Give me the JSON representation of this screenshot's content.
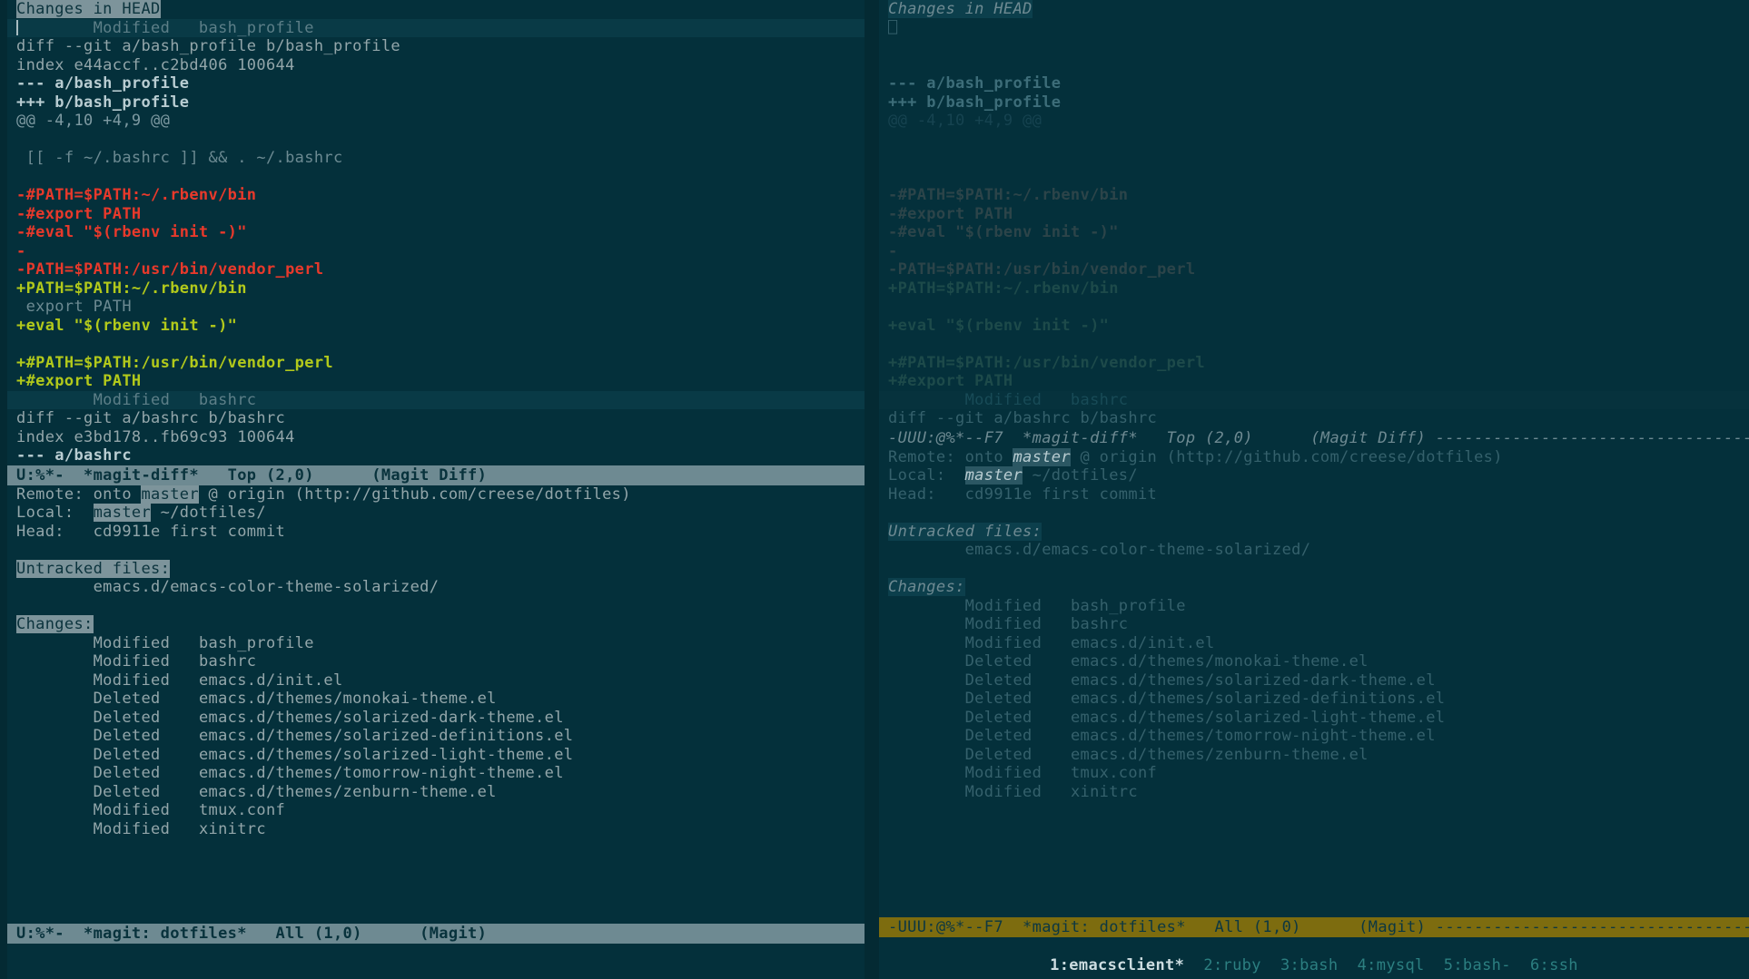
{
  "theme": {
    "background": "#042a33",
    "pane_background": "#04303b",
    "foreground": "#93a6aa",
    "diff_added": "#b2c91b",
    "diff_removed": "#e8392b",
    "modeline_active_bg": "#6e8a92",
    "modeline_tmux_active_bg": "#7d6c0f",
    "highlight_bg": "#7d949b"
  },
  "left_pane": {
    "name": "active-emacs-frame",
    "diff_buffer": {
      "header": "Changes in HEAD",
      "lines": [
        {
          "text": "        Modified   bash_profile",
          "face": "section-header",
          "cursor": true
        },
        {
          "text": "diff --git a/bash_profile b/bash_profile",
          "face": "normal"
        },
        {
          "text": "index e44accf..c2bd406 100644",
          "face": "normal"
        },
        {
          "text": "--- a/bash_profile",
          "face": "bold"
        },
        {
          "text": "+++ b/bash_profile",
          "face": "bold"
        },
        {
          "text": "@@ -4,10 +4,9 @@",
          "face": "hunk"
        },
        {
          "text": "",
          "face": "normal"
        },
        {
          "text": " [[ -f ~/.bashrc ]] && . ~/.bashrc",
          "face": "context"
        },
        {
          "text": "",
          "face": "normal"
        },
        {
          "text": "-#PATH=$PATH:~/.rbenv/bin",
          "face": "removed"
        },
        {
          "text": "-#export PATH",
          "face": "removed"
        },
        {
          "text": "-#eval \"$(rbenv init -)\"",
          "face": "removed"
        },
        {
          "text": "-",
          "face": "removed"
        },
        {
          "text": "-PATH=$PATH:/usr/bin/vendor_perl",
          "face": "removed"
        },
        {
          "text": "+PATH=$PATH:~/.rbenv/bin",
          "face": "added"
        },
        {
          "text": " export PATH",
          "face": "context"
        },
        {
          "text": "+eval \"$(rbenv init -)\"",
          "face": "added"
        },
        {
          "text": "",
          "face": "normal"
        },
        {
          "text": "+#PATH=$PATH:/usr/bin/vendor_perl",
          "face": "added"
        },
        {
          "text": "+#export PATH",
          "face": "added"
        },
        {
          "text": "        Modified   bashrc",
          "face": "section-header"
        },
        {
          "text": "diff --git a/bashrc b/bashrc",
          "face": "normal"
        },
        {
          "text": "index e3bd178..fb69c93 100644",
          "face": "normal"
        },
        {
          "text": "--- a/bashrc",
          "face": "bold"
        }
      ],
      "modeline": {
        "flags": "U:%*-",
        "buffer_name": "*magit-diff*",
        "position": "Top (2,0)",
        "major_mode": "(Magit Diff)",
        "full": "U:%*-  *magit-diff*   Top (2,0)      (Magit Diff)"
      }
    },
    "status_buffer": {
      "repo_info": [
        {
          "label": "Remote:",
          "prefix": "onto ",
          "branch": "master",
          "suffix": " @ origin (http://github.com/creese/dotfiles)"
        },
        {
          "label": "Local:",
          "prefix": "",
          "branch": "master",
          "suffix": " ~/dotfiles/"
        },
        {
          "label": "Head:",
          "prefix": "",
          "branch": "",
          "suffix": "cd9911e first commit"
        }
      ],
      "untracked_header": "Untracked files:",
      "untracked_files": [
        "emacs.d/emacs-color-theme-solarized/"
      ],
      "changes_header": "Changes:",
      "changes": [
        {
          "status": "Modified",
          "path": "bash_profile"
        },
        {
          "status": "Modified",
          "path": "bashrc"
        },
        {
          "status": "Modified",
          "path": "emacs.d/init.el"
        },
        {
          "status": "Deleted",
          "path": "emacs.d/themes/monokai-theme.el"
        },
        {
          "status": "Deleted",
          "path": "emacs.d/themes/solarized-dark-theme.el"
        },
        {
          "status": "Deleted",
          "path": "emacs.d/themes/solarized-definitions.el"
        },
        {
          "status": "Deleted",
          "path": "emacs.d/themes/solarized-light-theme.el"
        },
        {
          "status": "Deleted",
          "path": "emacs.d/themes/tomorrow-night-theme.el"
        },
        {
          "status": "Deleted",
          "path": "emacs.d/themes/zenburn-theme.el"
        },
        {
          "status": "Modified",
          "path": "tmux.conf"
        },
        {
          "status": "Modified",
          "path": "xinitrc"
        }
      ],
      "modeline": {
        "flags": "U:%*-",
        "buffer_name": "*magit: dotfiles*",
        "position": "All (1,0)",
        "major_mode": "(Magit)",
        "full": "U:%*-  *magit: dotfiles*   All (1,0)      (Magit)"
      }
    }
  },
  "right_pane": {
    "name": "inactive-emacs-frame",
    "diff_buffer": {
      "header": "Changes in HEAD",
      "lines": [
        {
          "text": "⎕",
          "face": "normal"
        },
        {
          "text": "",
          "face": "normal"
        },
        {
          "text": "",
          "face": "normal"
        },
        {
          "text": "--- a/bash_profile",
          "face": "bold"
        },
        {
          "text": "+++ b/bash_profile",
          "face": "bold"
        },
        {
          "text": "@@ -4,10 +4,9 @@",
          "face": "hunk"
        },
        {
          "text": "",
          "face": "normal"
        },
        {
          "text": "",
          "face": "normal"
        },
        {
          "text": "",
          "face": "normal"
        },
        {
          "text": "-#PATH=$PATH:~/.rbenv/bin",
          "face": "removed"
        },
        {
          "text": "-#export PATH",
          "face": "removed"
        },
        {
          "text": "-#eval \"$(rbenv init -)\"",
          "face": "removed"
        },
        {
          "text": "-",
          "face": "removed"
        },
        {
          "text": "-PATH=$PATH:/usr/bin/vendor_perl",
          "face": "removed"
        },
        {
          "text": "+PATH=$PATH:~/.rbenv/bin",
          "face": "added"
        },
        {
          "text": "",
          "face": "context"
        },
        {
          "text": "+eval \"$(rbenv init -)\"",
          "face": "added"
        },
        {
          "text": "",
          "face": "normal"
        },
        {
          "text": "+#PATH=$PATH:/usr/bin/vendor_perl",
          "face": "added"
        },
        {
          "text": "+#export PATH",
          "face": "added"
        },
        {
          "text": "        Modified   bashrc",
          "face": "section-header"
        },
        {
          "text": "diff --git a/bashrc b/bashrc",
          "face": "normal"
        }
      ],
      "modeline": {
        "full": "-UUU:@%*--F7  *magit-diff*   Top (2,0)      (Magit Diff) ",
        "flags": "-UUU:@%*--F7",
        "buffer_name": "*magit-diff*",
        "position": "Top (2,0)",
        "major_mode": "(Magit Diff)",
        "dashes": "--------------------------------------------------------"
      }
    },
    "status_buffer": {
      "repo_info": [
        {
          "label": "Remote:",
          "prefix": "onto ",
          "branch": "master",
          "suffix": " @ origin (http://github.com/creese/dotfiles)"
        },
        {
          "label": "Local:",
          "prefix": "",
          "branch": "master",
          "suffix": " ~/dotfiles/"
        },
        {
          "label": "Head:",
          "prefix": "",
          "branch": "",
          "suffix": "cd9911e first commit"
        }
      ],
      "untracked_header": "Untracked files:",
      "untracked_files": [
        "emacs.d/emacs-color-theme-solarized/"
      ],
      "changes_header": "Changes:",
      "changes": [
        {
          "status": "Modified",
          "path": "bash_profile"
        },
        {
          "status": "Modified",
          "path": "bashrc"
        },
        {
          "status": "Modified",
          "path": "emacs.d/init.el"
        },
        {
          "status": "Deleted",
          "path": "emacs.d/themes/monokai-theme.el"
        },
        {
          "status": "Deleted",
          "path": "emacs.d/themes/solarized-dark-theme.el"
        },
        {
          "status": "Deleted",
          "path": "emacs.d/themes/solarized-definitions.el"
        },
        {
          "status": "Deleted",
          "path": "emacs.d/themes/solarized-light-theme.el"
        },
        {
          "status": "Deleted",
          "path": "emacs.d/themes/tomorrow-night-theme.el"
        },
        {
          "status": "Deleted",
          "path": "emacs.d/themes/zenburn-theme.el"
        },
        {
          "status": "Modified",
          "path": "tmux.conf"
        },
        {
          "status": "Modified",
          "path": "xinitrc"
        }
      ],
      "modeline": {
        "full": "-UUU:@%*--F7  *magit: dotfiles*   All (1,0)      (Magit) ",
        "flags": "-UUU:@%*--F7",
        "buffer_name": "*magit: dotfiles*",
        "position": "All (1,0)",
        "major_mode": "(Magit)",
        "dashes": "------------------------------------------------------------"
      }
    }
  },
  "tmux_status": {
    "windows": [
      {
        "label": "1:emacsclient*",
        "active": true
      },
      {
        "label": "2:ruby",
        "active": false
      },
      {
        "label": "3:bash",
        "active": false
      },
      {
        "label": "4:mysql",
        "active": false
      },
      {
        "label": "5:bash-",
        "active": false
      },
      {
        "label": "6:ssh",
        "active": false
      }
    ]
  }
}
